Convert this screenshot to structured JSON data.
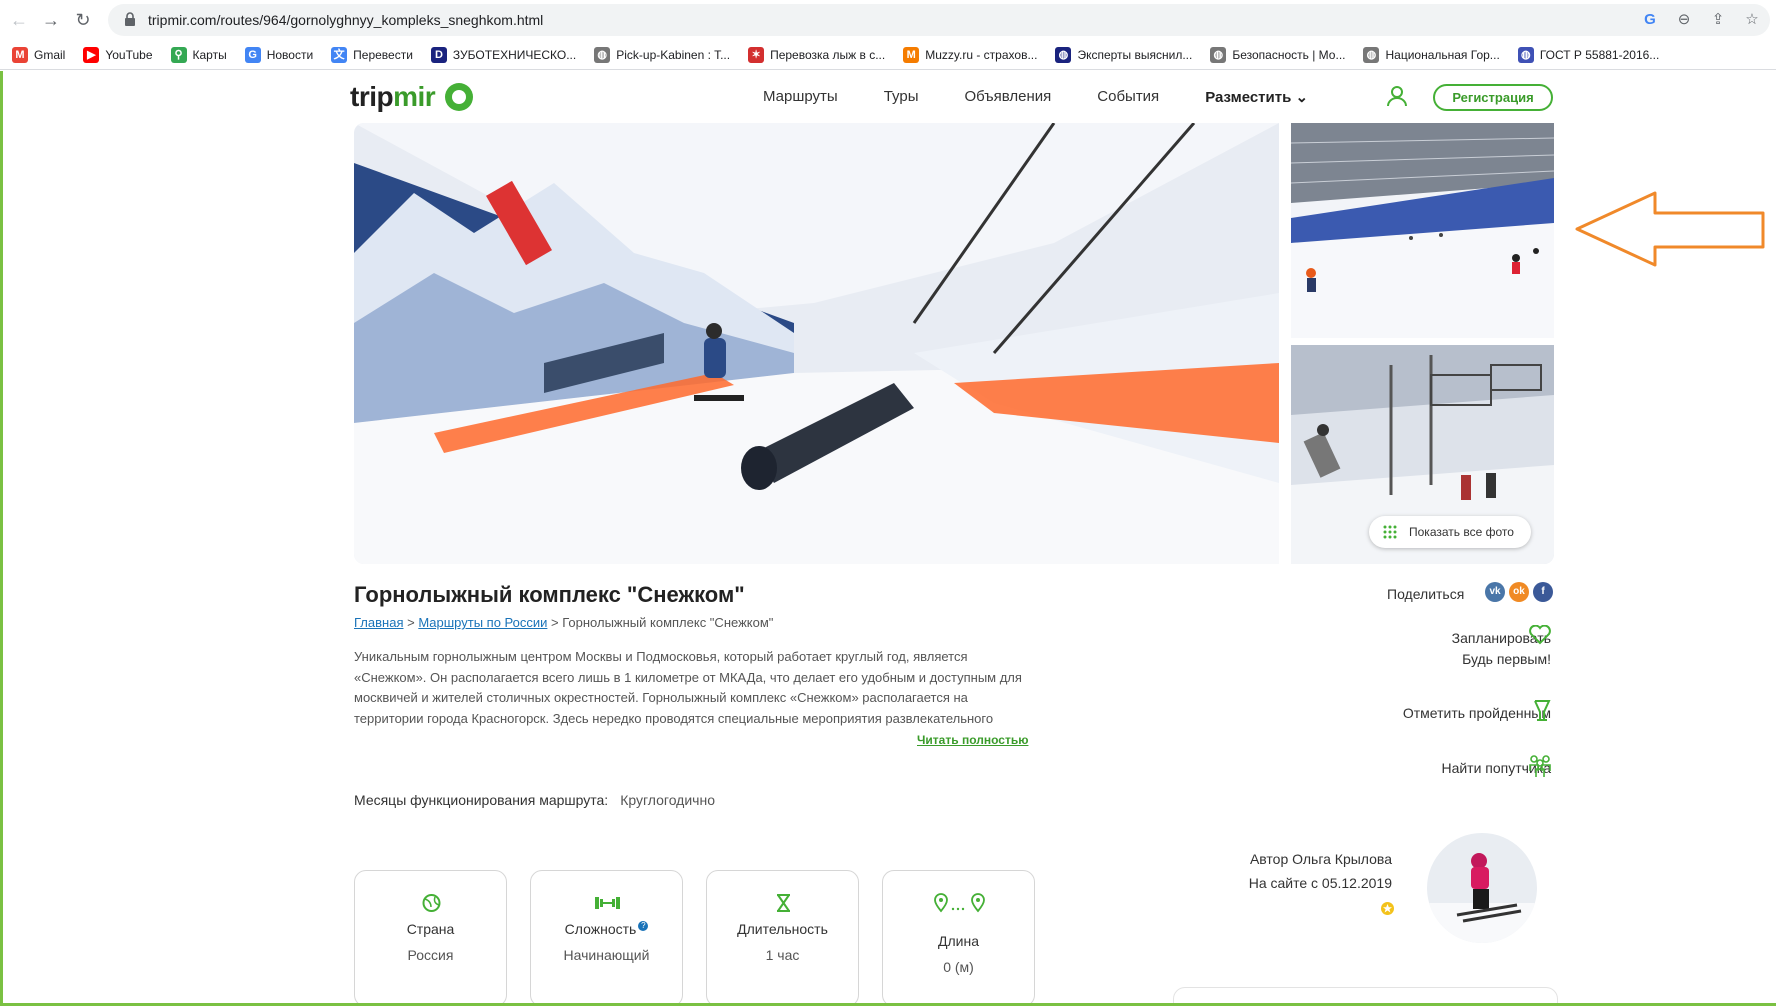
{
  "browser": {
    "url": "tripmir.com/routes/964/gornolyghnyy_kompleks_sneghkom.html",
    "bookmarks": [
      {
        "label": "Gmail",
        "icon": "gmail-icon",
        "color": "#ea4335",
        "glyph": "M"
      },
      {
        "label": "YouTube",
        "icon": "youtube-icon",
        "color": "#ff0000",
        "glyph": "▶"
      },
      {
        "label": "Карты",
        "icon": "maps-icon",
        "color": "#34a853",
        "glyph": "⚲"
      },
      {
        "label": "Новости",
        "icon": "news-icon",
        "color": "#4285f4",
        "glyph": "G"
      },
      {
        "label": "Перевести",
        "icon": "translate-icon",
        "color": "#4285f4",
        "glyph": "文"
      },
      {
        "label": "ЗУБОТЕХНИЧЕСКО...",
        "icon": "d-icon",
        "color": "#1a237e",
        "glyph": "D"
      },
      {
        "label": "Pick-up-Kabinen : T...",
        "icon": "globe-icon",
        "color": "#777777",
        "glyph": "◍"
      },
      {
        "label": "Перевозка лыж в с...",
        "icon": "star-icon",
        "color": "#d32f2f",
        "glyph": "✶"
      },
      {
        "label": "Muzzy.ru - страхов...",
        "icon": "muzzy-icon",
        "color": "#f57c00",
        "glyph": "M"
      },
      {
        "label": "Эксперты выяснил...",
        "icon": "globe-icon",
        "color": "#1a237e",
        "glyph": "◍"
      },
      {
        "label": "Безопасность | Мо...",
        "icon": "globe-icon",
        "color": "#777777",
        "glyph": "◍"
      },
      {
        "label": "Национальная Гор...",
        "icon": "globe-icon",
        "color": "#777777",
        "glyph": "◍"
      },
      {
        "label": "ГОСТ Р 55881-2016...",
        "icon": "globe-icon",
        "color": "#3f51b5",
        "glyph": "◍"
      }
    ]
  },
  "header": {
    "logo_trip": "trip",
    "logo_mir": "mir",
    "menu": [
      "Маршруты",
      "Туры",
      "Объявления",
      "События",
      "Разместить"
    ],
    "register": "Регистрация"
  },
  "gallery": {
    "show_all": "Показать все фото"
  },
  "route": {
    "title": "Горнолыжный комплекс \"Снежком\"",
    "breadcrumbs": [
      "Главная",
      "Маршруты по России",
      "Горнолыжный комплекс \"Снежком\""
    ],
    "description": "Уникальным горнолыжным центром Москвы и Подмосковья, который работает круглый год, является «Снежком». Он располагается всего лишь в 1 километре от МКАДа, что делает его удобным и доступным для москвичей и жителей столичных окрестностей. Горнолыжный комплекс «Снежком» располагается на территории города Красногорск. Здесь нередко проводятся специальные мероприятия развлекательного",
    "read_more": "Читать полностью",
    "months_label": "Месяцы функционирования маршрута:",
    "months_value": "Круглогодично"
  },
  "actions": {
    "share": "Поделиться",
    "plan": "Запланировать",
    "be_first": "Будь первым!",
    "visited": "Отметить пройденным",
    "companion": "Найти попутчика"
  },
  "author": {
    "name_line": "Автор Ольга Крылова",
    "since": "На сайте с 05.12.2019"
  },
  "cards": [
    {
      "label": "Страна",
      "value": "Россия",
      "icon": "globe-icon"
    },
    {
      "label": "Сложность",
      "value": "Начинающий",
      "icon": "dumbbell-icon"
    },
    {
      "label": "Длительность",
      "value": "1 час",
      "icon": "hourglass-icon"
    },
    {
      "label": "Длина",
      "value": "0 (м)",
      "icon": "route-pins-icon"
    }
  ],
  "colors": {
    "accent": "#45b036",
    "link": "#1a73b8",
    "arrow": "#f0892a"
  }
}
